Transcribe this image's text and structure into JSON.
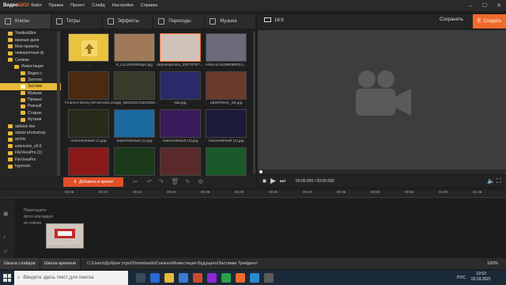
{
  "app": {
    "logo_a": "Видео",
    "logo_b": "ШОУ"
  },
  "menu": [
    "Файл",
    "Правка",
    "Проект",
    "Слайд",
    "Настройки",
    "Справка"
  ],
  "tabs": [
    "Клипы",
    "Титры",
    "Эффекты",
    "Переходы",
    "Музыка"
  ],
  "tree": [
    "YandexElire",
    "важные данн",
    "Мои проекты",
    "невероятные ф",
    "Снежан",
    "Инвестиция",
    "Видео с",
    "Заготов",
    "Заставк",
    "Музыка",
    "Превью",
    "Разный",
    "Старые",
    "Футажи",
    "ableton live",
    "adobe photoshop",
    "archiv",
    "extension_v0.6",
    "FileViewPro (1)",
    "FileViewPro",
    "hypnosis"
  ],
  "thumbs": [
    {
      "cap": "...",
      "bg": "#e8c341"
    },
    {
      "cap": "8_LxL2MU6Wagn.jpg",
      "bg": "#a07a58"
    },
    {
      "cap": "depositphotos_33070787-...",
      "bg": "#d0c2b8"
    },
    {
      "cap": "e49cc4c3cd56086f3cc...",
      "bg": "#6a6a7a"
    },
    {
      "cap": "Finance-binary-60-second...",
      "bg": "#4a2a10"
    },
    {
      "cap": "image_862201171203282...",
      "bg": "#3a3a2a"
    },
    {
      "cap": "kak.jpg",
      "bg": "#2a2a6a"
    },
    {
      "cap": "LBGRHsvC_tiE.jpg",
      "bg": "#6a3a2a"
    },
    {
      "cap": "maxresdefault (1).jpg",
      "bg": "#2a2a1a"
    },
    {
      "cap": "maxresdefault (2).jpg",
      "bg": "#1a6aa0"
    },
    {
      "cap": "maxresdefault (3).jpg",
      "bg": "#3a1a5a"
    },
    {
      "cap": "maxresdefault (4).jpg",
      "bg": "#1a1a3a"
    },
    {
      "cap": "",
      "bg": "#8a1a1a"
    },
    {
      "cap": "",
      "bg": "#1a3a1a"
    },
    {
      "cap": "",
      "bg": "#5a2a2a"
    },
    {
      "cap": "",
      "bg": "#1a5a2a"
    }
  ],
  "preview": {
    "ratio": "16:9",
    "save": "Сохранить",
    "create": "Создать",
    "timecode": "00:00.000 / 00:00.000"
  },
  "editor": {
    "add_button": "Добавить в проект"
  },
  "ruler": [
    "00:05",
    "00:10",
    "00:15",
    "00:20",
    "00:25",
    "00:30",
    "00:35",
    "00:40",
    "00:45",
    "00:50",
    "00:55",
    "01:00",
    "01:05"
  ],
  "timeline": {
    "hint": "Перетащите фото или видео из списка",
    "clip_label": "depositphotos_33070787-..."
  },
  "status": {
    "slides": "Шкала слайдов",
    "timeline": "Шкала времени",
    "path": "C:\\Users\\Доброе утро!\\Downloads\\Снежан\\Инвестиция Будущего\\Заставки Трейдинг\\",
    "zoom": "100%"
  },
  "taskbar": {
    "search": "Введите здесь текст для поиска",
    "lang": "РУС",
    "time": "19:53",
    "date": "02.03.2021"
  },
  "colors": {
    "accent": "#f06a2a",
    "folder": "#e8b93a"
  }
}
